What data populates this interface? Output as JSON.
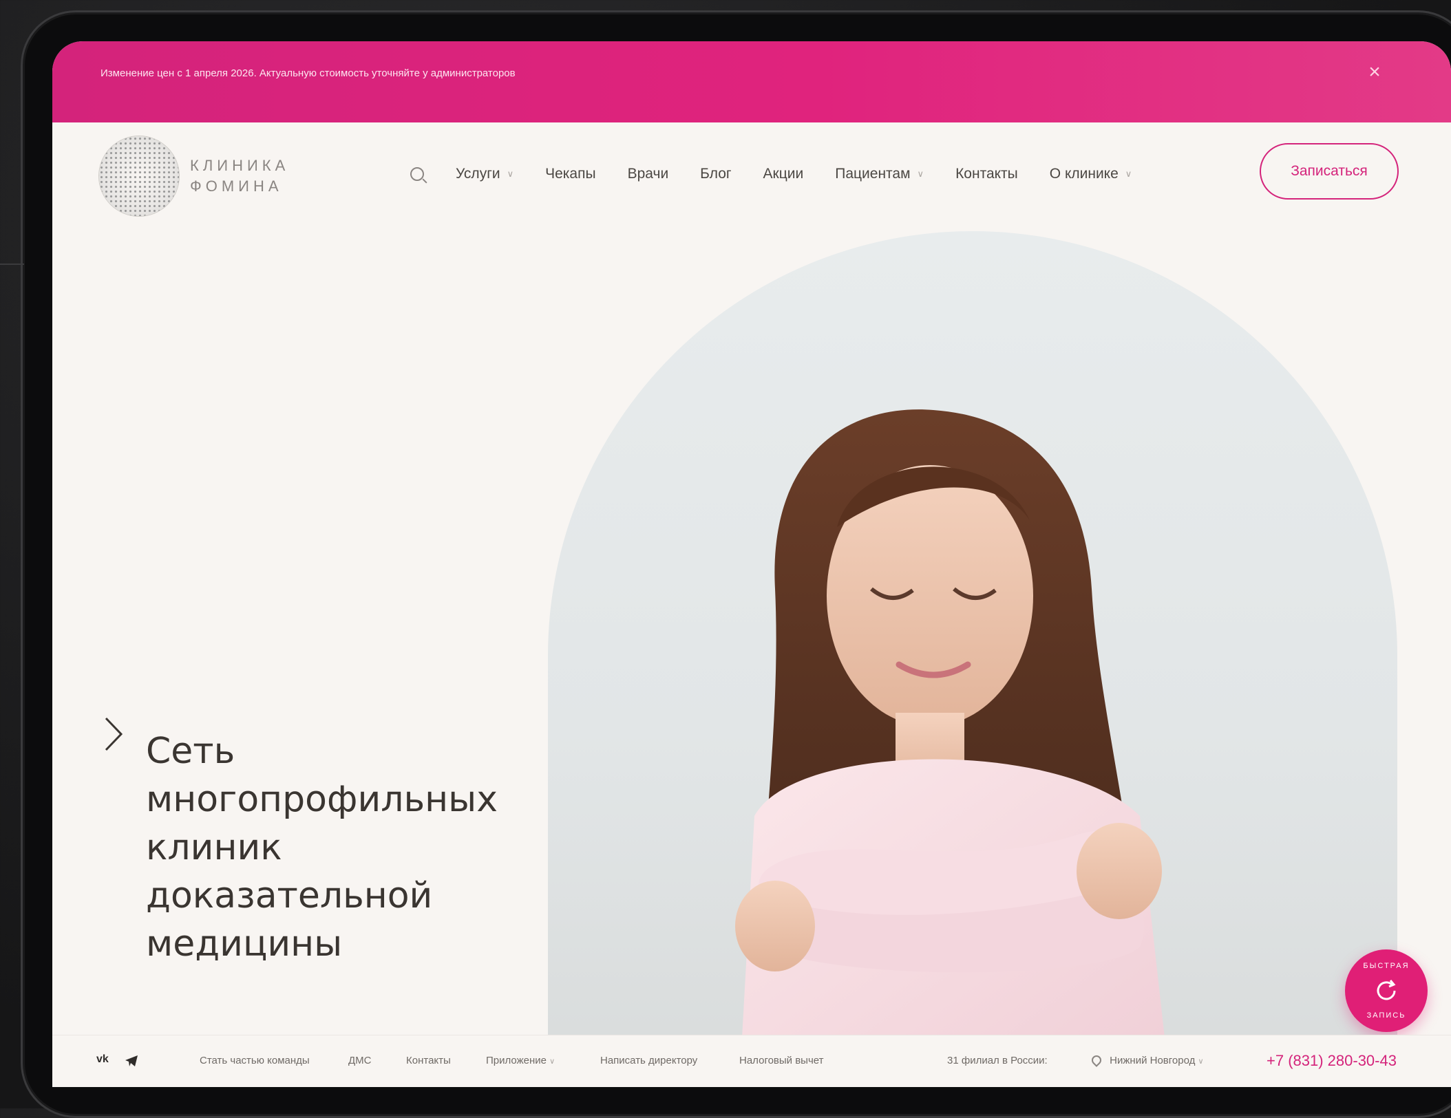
{
  "banner": {
    "text": "Изменение цен с 1 апреля 2026. Актуальную стоимость уточняйте у администраторов",
    "close_icon": "close-icon"
  },
  "header": {
    "logo_line1": "КЛИНИКА",
    "logo_line2": "ФОМИНА",
    "nav": [
      {
        "label": "Услуги",
        "dropdown": true
      },
      {
        "label": "Чекапы",
        "dropdown": false
      },
      {
        "label": "Врачи",
        "dropdown": false
      },
      {
        "label": "Блог",
        "dropdown": false
      },
      {
        "label": "Акции",
        "dropdown": false
      },
      {
        "label": "Пациентам",
        "dropdown": true
      },
      {
        "label": "Контакты",
        "dropdown": false
      },
      {
        "label": "О клинике",
        "dropdown": true
      }
    ],
    "cta": "Записаться"
  },
  "hero": {
    "headline": [
      "Сеть",
      "многопрофильных",
      "клиник",
      "доказательной",
      "медицины"
    ]
  },
  "quick_book": {
    "top": "БЫСТРАЯ",
    "bottom": "ЗАПИСЬ"
  },
  "footer": {
    "links": [
      "Стать частью команды",
      "ДМС",
      "Контакты",
      "Приложение",
      "Написать директору",
      "Налоговый вычет"
    ],
    "branches": "31 филиал в России:",
    "city": "Нижний Новгород",
    "phone": "+7 (831) 280-30-43"
  },
  "colors": {
    "accent": "#d4237b",
    "banner": "#e0237d",
    "background": "#f8f5f2"
  }
}
